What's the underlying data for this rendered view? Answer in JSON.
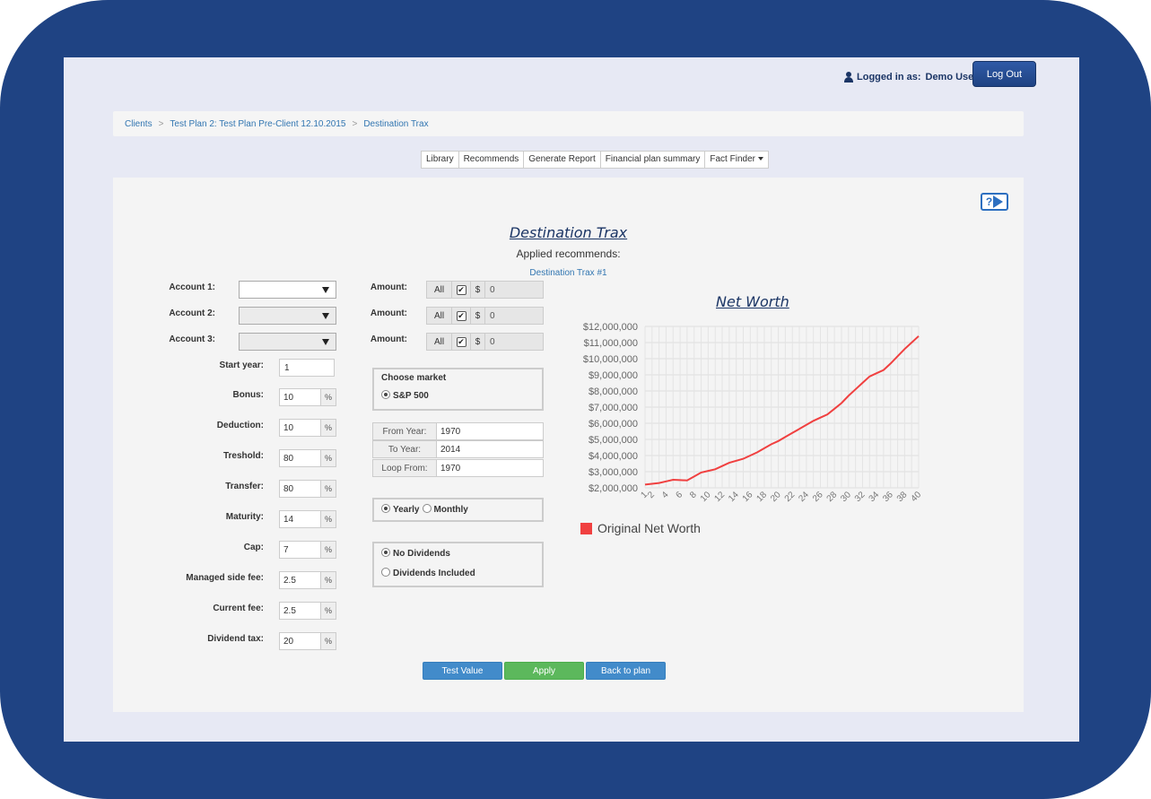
{
  "header": {
    "logged_in_label": "Logged in as:",
    "user_name": "Demo User",
    "logout_label": "Log Out"
  },
  "breadcrumb": [
    "Clients",
    "Test Plan 2: Test Plan Pre-Client 12.10.2015",
    "Destination Trax"
  ],
  "tabs": [
    "Library",
    "Recommends",
    "Generate Report",
    "Financial plan summary",
    "Fact Finder"
  ],
  "page": {
    "title": "Destination Trax",
    "subtitle": "Applied recommends:",
    "recommend_link": "Destination Trax #1",
    "help_label": "?"
  },
  "accounts": [
    {
      "label": "Account 1:",
      "amount_label": "Amount:",
      "all_label": "All",
      "currency": "$",
      "value": "0",
      "enabled": true
    },
    {
      "label": "Account 2:",
      "amount_label": "Amount:",
      "all_label": "All",
      "currency": "$",
      "value": "0",
      "enabled": false
    },
    {
      "label": "Account 3:",
      "amount_label": "Amount:",
      "all_label": "All",
      "currency": "$",
      "value": "0",
      "enabled": false
    }
  ],
  "fields": {
    "start_year": {
      "label": "Start year:",
      "value": "1"
    },
    "percent_fields": [
      {
        "label": "Bonus:",
        "value": "10"
      },
      {
        "label": "Deduction:",
        "value": "10"
      },
      {
        "label": "Treshold:",
        "value": "80"
      },
      {
        "label": "Transfer:",
        "value": "80"
      },
      {
        "label": "Maturity:",
        "value": "14"
      },
      {
        "label": "Cap:",
        "value": "7"
      },
      {
        "label": "Managed side fee:",
        "value": "2.5"
      },
      {
        "label": "Current fee:",
        "value": "2.5"
      },
      {
        "label": "Dividend tax:",
        "value": "20"
      }
    ],
    "percent_symbol": "%"
  },
  "market": {
    "title": "Choose market",
    "option": "S&P 500"
  },
  "years": [
    {
      "label": "From Year:",
      "value": "1970"
    },
    {
      "label": "To Year:",
      "value": "2014"
    },
    {
      "label": "Loop From:",
      "value": "1970"
    }
  ],
  "frequency": {
    "yearly": "Yearly",
    "monthly": "Monthly",
    "selected": "yearly"
  },
  "dividends": {
    "no": "No Dividends",
    "included": "Dividends Included",
    "selected": "no"
  },
  "buttons": {
    "test_value": "Test Value",
    "apply": "Apply",
    "back": "Back to plan"
  },
  "colors": {
    "frame": "#1f4383",
    "line": "#f04040",
    "link": "#3276b1",
    "apply": "#5cb85c",
    "primary": "#428bca"
  },
  "chart_data": {
    "type": "line",
    "title": "Net Worth",
    "x": [
      1,
      2,
      3,
      4,
      5,
      6,
      7,
      8,
      9,
      10,
      11,
      12,
      13,
      14,
      15,
      16,
      17,
      18,
      19,
      20,
      21,
      22,
      23,
      24,
      25,
      26,
      27,
      28,
      29,
      30,
      31,
      32,
      33,
      34,
      35,
      36,
      37,
      38,
      39,
      40
    ],
    "x_tick_labels": [
      "1",
      "2",
      "4",
      "6",
      "8",
      "10",
      "12",
      "14",
      "16",
      "18",
      "20",
      "22",
      "24",
      "26",
      "28",
      "30",
      "32",
      "34",
      "36",
      "38",
      "40"
    ],
    "series": [
      {
        "name": "Original Net Worth",
        "values": [
          2200000,
          2250000,
          2300000,
          2400000,
          2500000,
          2480000,
          2460000,
          2700000,
          2950000,
          3050000,
          3150000,
          3350000,
          3550000,
          3680000,
          3800000,
          4000000,
          4200000,
          4450000,
          4700000,
          4900000,
          5150000,
          5400000,
          5650000,
          5900000,
          6150000,
          6350000,
          6550000,
          6900000,
          7250000,
          7700000,
          8100000,
          8500000,
          8900000,
          9100000,
          9300000,
          9700000,
          10150000,
          10600000,
          11000000,
          11400000
        ]
      }
    ],
    "ylim": [
      2000000,
      12000000
    ],
    "y_ticks": [
      "$2,000,000",
      "$3,000,000",
      "$4,000,000",
      "$5,000,000",
      "$6,000,000",
      "$7,000,000",
      "$8,000,000",
      "$9,000,000",
      "$10,000,000",
      "$11,000,000",
      "$12,000,000"
    ],
    "grid": true,
    "legend": "bottom-left"
  }
}
